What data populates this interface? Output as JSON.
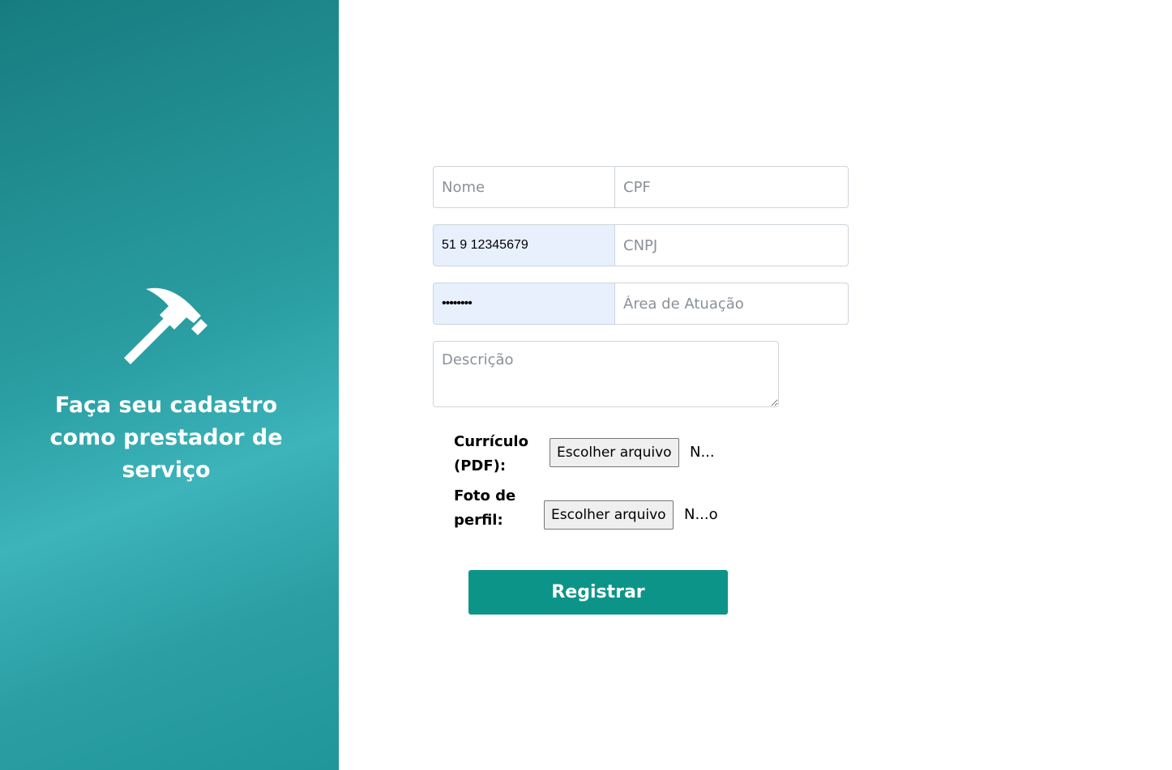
{
  "sidebar": {
    "tagline_line1": "Faça seu cadastro",
    "tagline_line2": "como prestador de",
    "tagline_line3": "serviço",
    "icon": "hammer-icon"
  },
  "form": {
    "nome": {
      "placeholder": "Nome",
      "value": ""
    },
    "cpf": {
      "placeholder": "CPF",
      "value": ""
    },
    "telefone": {
      "value": "51 9 12345679"
    },
    "cnpj": {
      "placeholder": "CNPJ",
      "value": ""
    },
    "senha": {
      "value": "••••••••"
    },
    "area": {
      "placeholder": "Área de Atuação",
      "value": ""
    },
    "descricao": {
      "placeholder": "Descrição"
    },
    "curriculo": {
      "label_line1": "Currículo",
      "label_line2": "(PDF):",
      "button": "Escolher arquivo",
      "status": "N..."
    },
    "foto": {
      "label_line1": "Foto de",
      "label_line2": "perfil:",
      "button": "Escolher arquivo",
      "status": "N...o"
    },
    "submit_label": "Registrar"
  },
  "colors": {
    "sidebar_gradient_start": "#177c80",
    "sidebar_gradient_mid": "#3cb4ba",
    "primary_button": "#0d9488",
    "autofill_bg": "#e8f0fe"
  }
}
